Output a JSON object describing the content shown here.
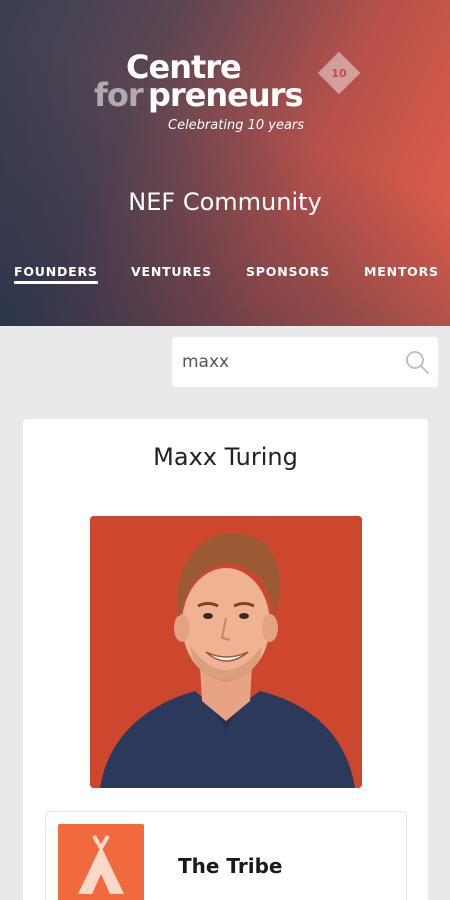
{
  "header": {
    "logo": {
      "word1": "Centre",
      "word2": "for",
      "word3": "preneurs",
      "tagline": "Celebrating 10 years",
      "badge": "10"
    },
    "title": "NEF Community",
    "tabs": [
      {
        "label": "FOUNDERS",
        "active": true
      },
      {
        "label": "VENTURES",
        "active": false
      },
      {
        "label": "SPONSORS",
        "active": false
      },
      {
        "label": "MENTORS",
        "active": false
      }
    ]
  },
  "search": {
    "value": "maxx"
  },
  "profile": {
    "name": "Maxx Turing",
    "photo_icon": "person-photo",
    "venture": {
      "name": "The Tribe",
      "logo_icon": "tent-icon"
    }
  },
  "colors": {
    "accent": "#f06a3e",
    "photo_background": "#c9422a",
    "page_background": "#e9e9e9"
  }
}
